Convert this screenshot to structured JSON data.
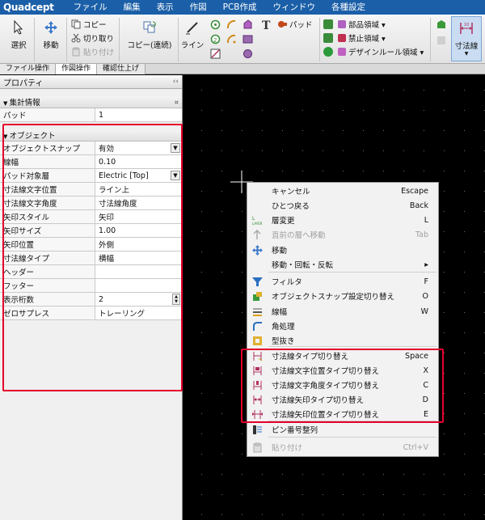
{
  "app": {
    "logo": "Quadcept"
  },
  "menu": [
    "ファイル",
    "編集",
    "表示",
    "作図",
    "PCB作成",
    "ウィンドウ",
    "各種設定"
  ],
  "ribbon": {
    "select": "選択",
    "move": "移動",
    "copy": "コピー",
    "cut": "切り取り",
    "paste": "貼り付け",
    "copy_continuous": "コピー(連続)",
    "line": "ライン",
    "pad": "パッド",
    "part_area": "部品領域 ▾",
    "prohibit_area": "禁止領域 ▾",
    "design_rule_area": "デザインルール領域 ▾",
    "dimension": "寸法線"
  },
  "tabs": [
    "ファイル操作",
    "作図操作",
    "確認仕上げ"
  ],
  "panel": {
    "title": "プロパティ",
    "collapse": "‹‹",
    "summary_section": "集計情報",
    "summary_pin": "¤",
    "summary_rows": [
      {
        "key": "パッド",
        "value": "1"
      }
    ],
    "object_section": "オブジェクト",
    "object_rows": [
      {
        "key": "オブジェクトスナップ",
        "value": "有効"
      },
      {
        "key": "線幅",
        "value": "0.10"
      },
      {
        "key": "パッド対象層",
        "value": "Electric [Top]"
      },
      {
        "key": "寸法線文字位置",
        "value": "ライン上"
      },
      {
        "key": "寸法線文字角度",
        "value": "寸法線角度"
      },
      {
        "key": "矢印スタイル",
        "value": "矢印"
      },
      {
        "key": "矢印サイズ",
        "value": "1.00"
      },
      {
        "key": "矢印位置",
        "value": "外側"
      },
      {
        "key": "寸法線タイプ",
        "value": "横幅"
      },
      {
        "key": "ヘッダー",
        "value": ""
      },
      {
        "key": "フッター",
        "value": ""
      },
      {
        "key": "表示桁数",
        "value": "2"
      },
      {
        "key": "ゼロサプレス",
        "value": "トレーリング"
      }
    ]
  },
  "context_menu": {
    "items": [
      {
        "label": "キャンセル",
        "shortcut": "Escape",
        "icon": "none-icon"
      },
      {
        "label": "ひとつ戻る",
        "shortcut": "Back",
        "icon": "none-icon"
      },
      {
        "label": "層変更",
        "shortcut": "L",
        "icon": "layer-icon"
      },
      {
        "label": "直前の層へ移動",
        "shortcut": "Tab",
        "icon": "prev-layer-icon"
      },
      {
        "label": "移動",
        "shortcut": "",
        "icon": "move-icon"
      },
      {
        "label": "移動・回転・反転",
        "shortcut": "▸",
        "icon": "none-icon"
      },
      {
        "label": "フィルタ",
        "shortcut": "F",
        "icon": "filter-icon"
      },
      {
        "label": "オブジェクトスナップ設定切り替え",
        "shortcut": "O",
        "icon": "snap-icon"
      },
      {
        "label": "線幅",
        "shortcut": "W",
        "icon": "line-width-icon"
      },
      {
        "label": "角処理",
        "shortcut": "",
        "icon": "corner-icon"
      },
      {
        "label": "型抜き",
        "shortcut": "",
        "icon": "cutout-icon"
      },
      {
        "label": "寸法線タイプ切り替え",
        "shortcut": "Space",
        "icon": "dim-type-icon"
      },
      {
        "label": "寸法線文字位置タイプ切り替え",
        "shortcut": "X",
        "icon": "dim-text-pos-icon"
      },
      {
        "label": "寸法線文字角度タイプ切り替え",
        "shortcut": "C",
        "icon": "dim-text-angle-icon"
      },
      {
        "label": "寸法線矢印タイプ切り替え",
        "shortcut": "D",
        "icon": "dim-arrow-icon"
      },
      {
        "label": "寸法線矢印位置タイプ切り替え",
        "shortcut": "E",
        "icon": "dim-arrow-pos-icon"
      },
      {
        "label": "ピン番号整列",
        "shortcut": "",
        "icon": "pin-align-icon"
      },
      {
        "label": "貼り付け",
        "shortcut": "Ctrl+V",
        "icon": "paste-icon"
      }
    ]
  },
  "colors": {
    "menubar": "#1b5fa8",
    "highlight_box": "#e4002b"
  }
}
